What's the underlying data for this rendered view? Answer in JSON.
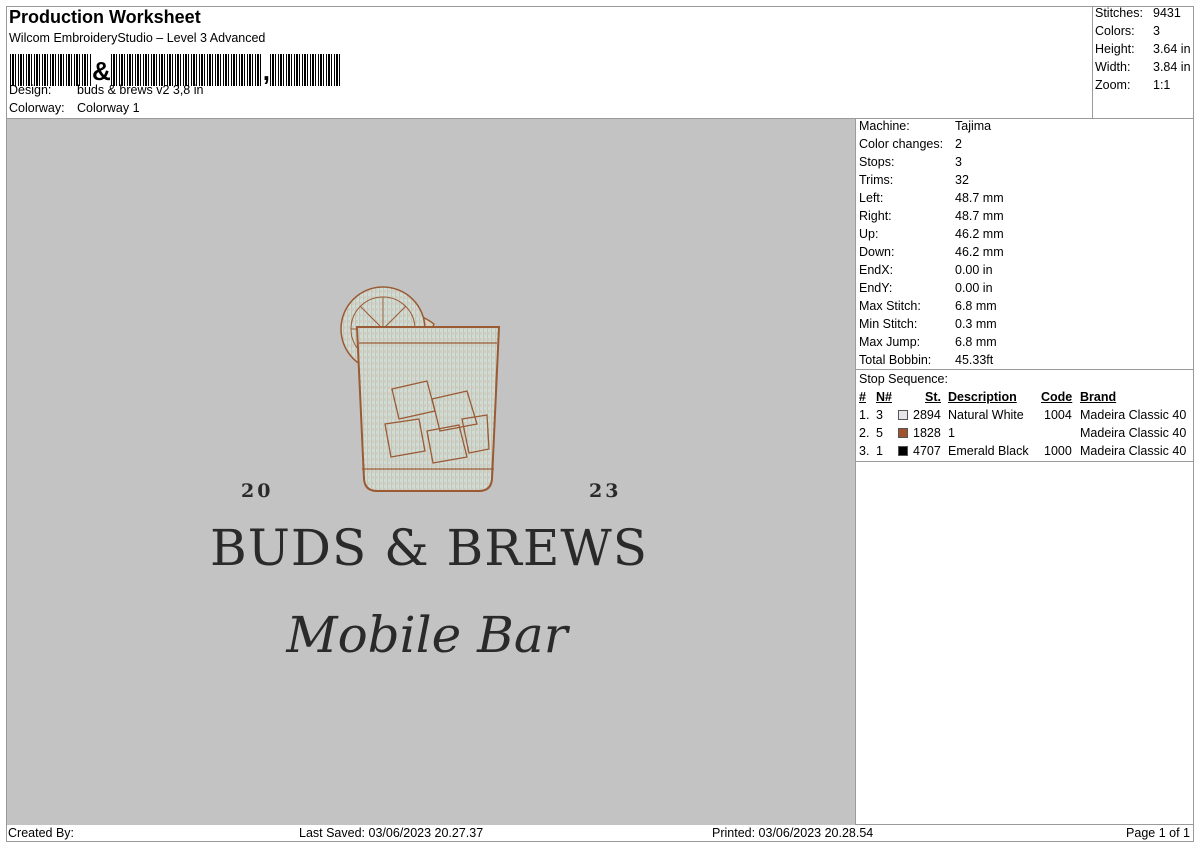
{
  "header": {
    "title": "Production Worksheet",
    "subtitle": "Wilcom EmbroideryStudio – Level 3 Advanced",
    "barcode": {
      "glyph_a": "&",
      "glyph_b": ","
    },
    "design_label": "Design:",
    "design_value": "buds & brews v2 3,8 in",
    "colorway_label": "Colorway:",
    "colorway_value": "Colorway 1"
  },
  "stats": [
    {
      "label": "Stitches:",
      "value": "9431"
    },
    {
      "label": "Colors:",
      "value": "3"
    },
    {
      "label": "Height:",
      "value": "3.64 in"
    },
    {
      "label": "Width:",
      "value": "3.84 in"
    },
    {
      "label": "Zoom:",
      "value": "1:1"
    }
  ],
  "machine_info": [
    {
      "label": "Machine:",
      "value": "Tajima"
    },
    {
      "label": "Color changes:",
      "value": "2"
    },
    {
      "label": "Stops:",
      "value": "3"
    },
    {
      "label": "Trims:",
      "value": "32"
    },
    {
      "label": "Left:",
      "value": "48.7 mm"
    },
    {
      "label": "Right:",
      "value": "48.7 mm"
    },
    {
      "label": "Up:",
      "value": "46.2 mm"
    },
    {
      "label": "Down:",
      "value": "46.2 mm"
    },
    {
      "label": "EndX:",
      "value": "0.00 in"
    },
    {
      "label": "EndY:",
      "value": "0.00 in"
    },
    {
      "label": "Max Stitch:",
      "value": "6.8 mm"
    },
    {
      "label": "Min Stitch:",
      "value": "0.3 mm"
    },
    {
      "label": "Max Jump:",
      "value": "6.8 mm"
    },
    {
      "label": "Total Bobbin:",
      "value": "45.33ft"
    }
  ],
  "stop_sequence": {
    "title": "Stop Sequence:",
    "headers": {
      "num": "#",
      "n": "N#",
      "st": "St.",
      "desc": "Description",
      "code": "Code",
      "brand": "Brand"
    },
    "rows": [
      {
        "num": "1.",
        "n": "3",
        "color": "#e6e6ea",
        "st": "2894",
        "desc": "Natural White",
        "code": "1004",
        "brand": "Madeira Classic 40"
      },
      {
        "num": "2.",
        "n": "5",
        "color": "#a0522d",
        "st": "1828",
        "desc": "1",
        "code": "",
        "brand": "Madeira Classic 40"
      },
      {
        "num": "3.",
        "n": "1",
        "color": "#000000",
        "st": "4707",
        "desc": "Emerald Black",
        "code": "1000",
        "brand": "Madeira Classic 40"
      }
    ]
  },
  "design": {
    "year_left": "20",
    "year_right": "23",
    "brand_name": "BUDS & BREWS",
    "tagline": "Mobile Bar",
    "thread_brown": "#9a5a34",
    "glass_fill": "#cfdcd6",
    "background": "#c3c3c3"
  },
  "footer": {
    "created_by": "Created By:",
    "last_saved": "Last Saved: 03/06/2023 20.27.37",
    "printed": "Printed: 03/06/2023 20.28.54",
    "page": "Page 1 of 1"
  }
}
